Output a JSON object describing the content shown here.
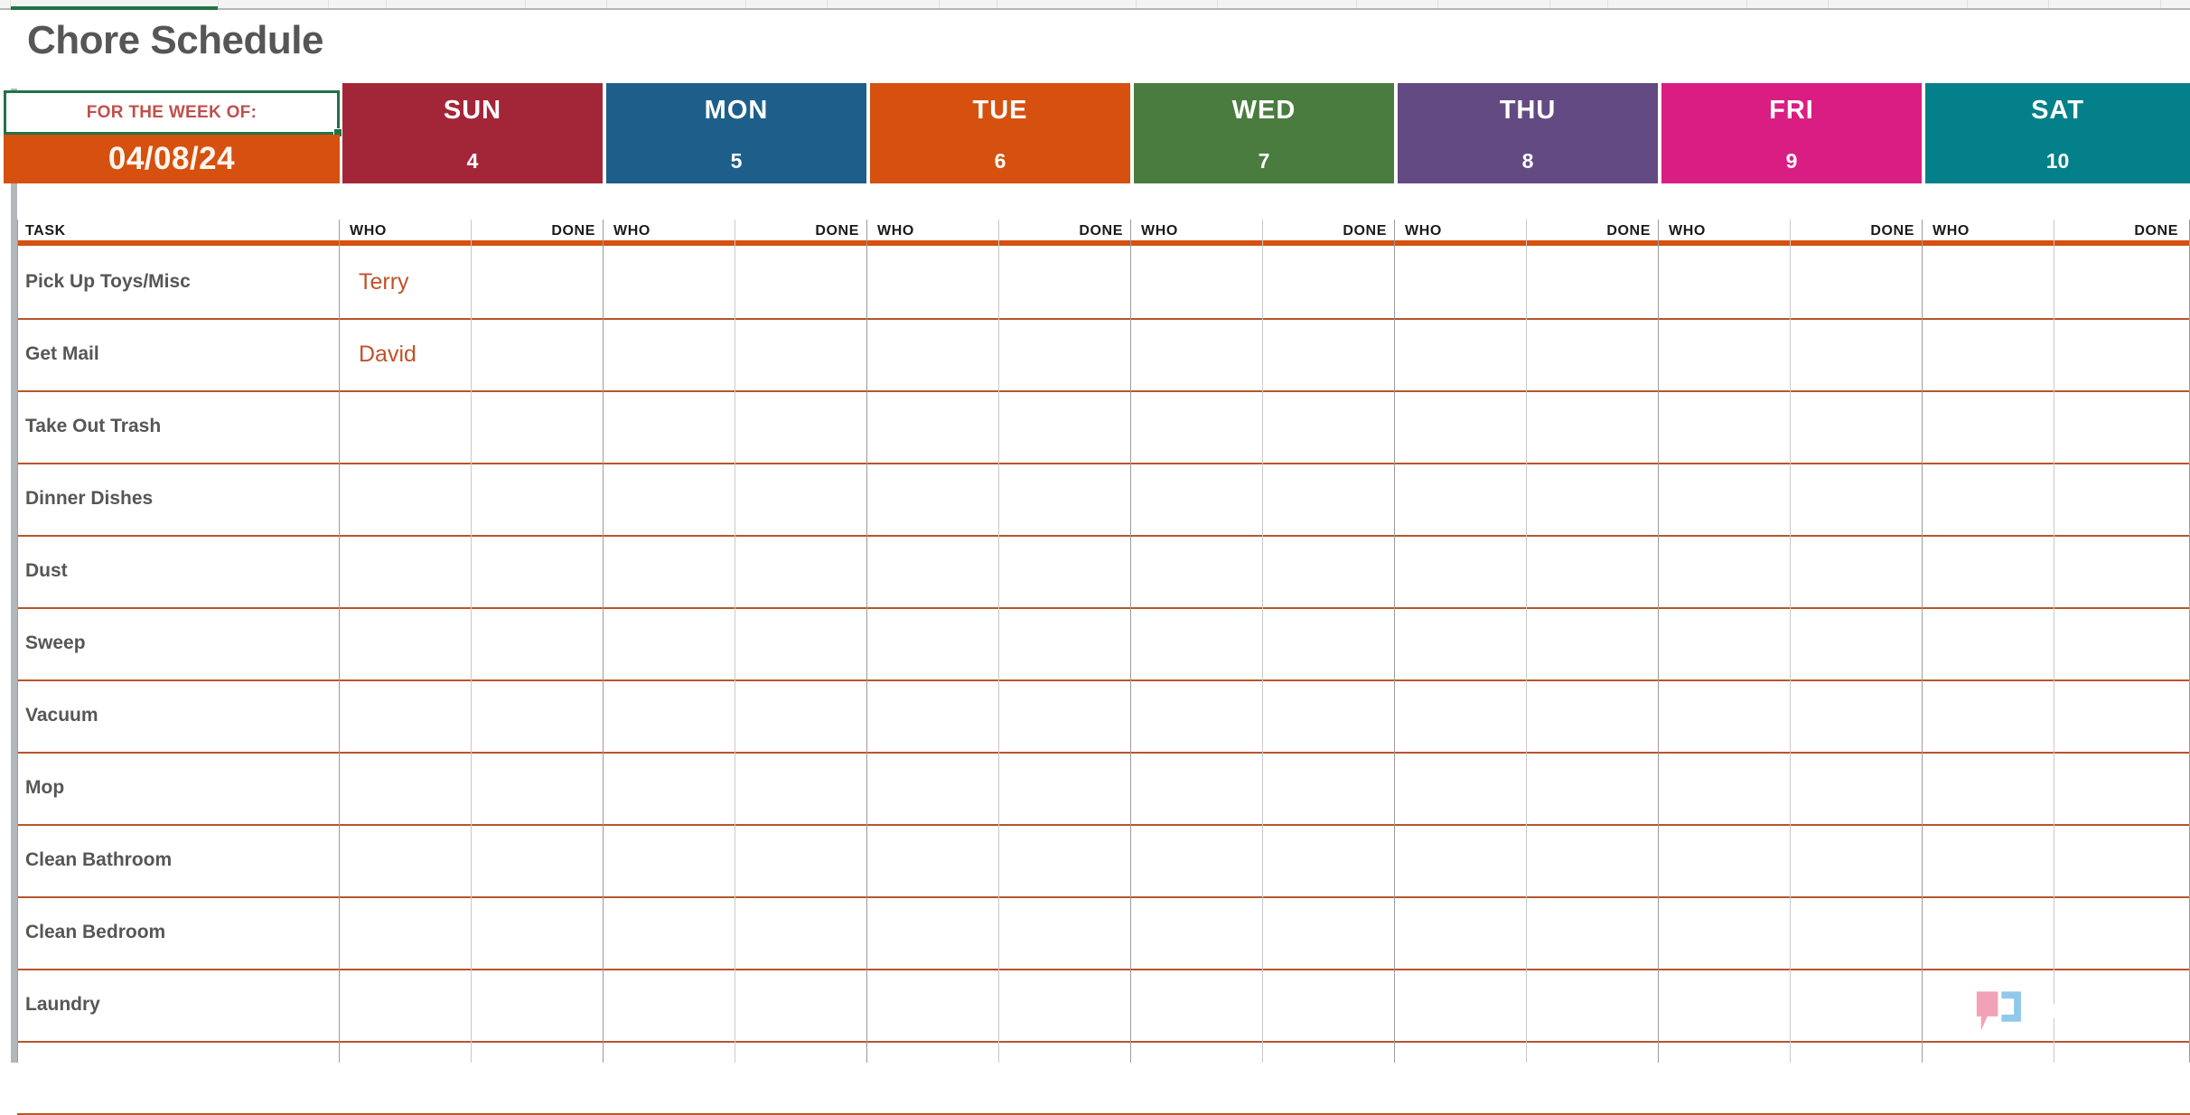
{
  "page_title": "Chore Schedule",
  "week_of": {
    "label": "FOR THE WEEK OF:",
    "date": "04/08/24"
  },
  "columns": {
    "task_header": "TASK",
    "who_header": "WHO",
    "done_header": "DONE"
  },
  "days": [
    {
      "name": "SUN",
      "date": "4",
      "color": "#a32638"
    },
    {
      "name": "MON",
      "date": "5",
      "color": "#1d5f8a"
    },
    {
      "name": "TUE",
      "date": "6",
      "color": "#d6500f"
    },
    {
      "name": "WED",
      "date": "7",
      "color": "#4a7c3f"
    },
    {
      "name": "THU",
      "date": "8",
      "color": "#634a83"
    },
    {
      "name": "FRI",
      "date": "9",
      "color": "#da1d82"
    },
    {
      "name": "SAT",
      "date": "10",
      "color": "#04808a"
    }
  ],
  "rows": [
    {
      "task": "Pick Up Toys/Misc",
      "assignments": [
        "Terry",
        "",
        "",
        "",
        "",
        "",
        ""
      ],
      "done": [
        "",
        "",
        "",
        "",
        "",
        "",
        ""
      ]
    },
    {
      "task": "Get Mail",
      "assignments": [
        "David",
        "",
        "",
        "",
        "",
        "",
        ""
      ],
      "done": [
        "",
        "",
        "",
        "",
        "",
        "",
        ""
      ]
    },
    {
      "task": "Take Out Trash",
      "assignments": [
        "",
        "",
        "",
        "",
        "",
        "",
        ""
      ],
      "done": [
        "",
        "",
        "",
        "",
        "",
        "",
        ""
      ]
    },
    {
      "task": "Dinner Dishes",
      "assignments": [
        "",
        "",
        "",
        "",
        "",
        "",
        ""
      ],
      "done": [
        "",
        "",
        "",
        "",
        "",
        "",
        ""
      ]
    },
    {
      "task": "Dust",
      "assignments": [
        "",
        "",
        "",
        "",
        "",
        "",
        ""
      ],
      "done": [
        "",
        "",
        "",
        "",
        "",
        "",
        ""
      ]
    },
    {
      "task": "Sweep",
      "assignments": [
        "",
        "",
        "",
        "",
        "",
        "",
        ""
      ],
      "done": [
        "",
        "",
        "",
        "",
        "",
        "",
        ""
      ]
    },
    {
      "task": "Vacuum",
      "assignments": [
        "",
        "",
        "",
        "",
        "",
        "",
        ""
      ],
      "done": [
        "",
        "",
        "",
        "",
        "",
        "",
        ""
      ]
    },
    {
      "task": "Mop",
      "assignments": [
        "",
        "",
        "",
        "",
        "",
        "",
        ""
      ],
      "done": [
        "",
        "",
        "",
        "",
        "",
        "",
        ""
      ]
    },
    {
      "task": "Clean Bathroom",
      "assignments": [
        "",
        "",
        "",
        "",
        "",
        "",
        ""
      ],
      "done": [
        "",
        "",
        "",
        "",
        "",
        "",
        ""
      ]
    },
    {
      "task": "Clean Bedroom",
      "assignments": [
        "",
        "",
        "",
        "",
        "",
        "",
        ""
      ],
      "done": [
        "",
        "",
        "",
        "",
        "",
        "",
        ""
      ]
    },
    {
      "task": "Laundry",
      "assignments": [
        "",
        "",
        "",
        "",
        "",
        "",
        ""
      ],
      "done": [
        "",
        "",
        "",
        "",
        "",
        "",
        ""
      ]
    },
    {
      "task": "",
      "assignments": [
        "",
        "",
        "",
        "",
        "",
        "",
        ""
      ],
      "done": [
        "",
        "",
        "",
        "",
        "",
        "",
        ""
      ]
    }
  ],
  "watermark": {
    "text": "XDA",
    "bracket_left_color": "#f2a0b4",
    "bracket_right_color": "#8ec7ea"
  },
  "theme": {
    "accent_orange": "#d6500f",
    "rule_orange": "#b8552b",
    "title_gray": "#565656",
    "name_orange": "#c0522a",
    "selection_green": "#217346"
  }
}
